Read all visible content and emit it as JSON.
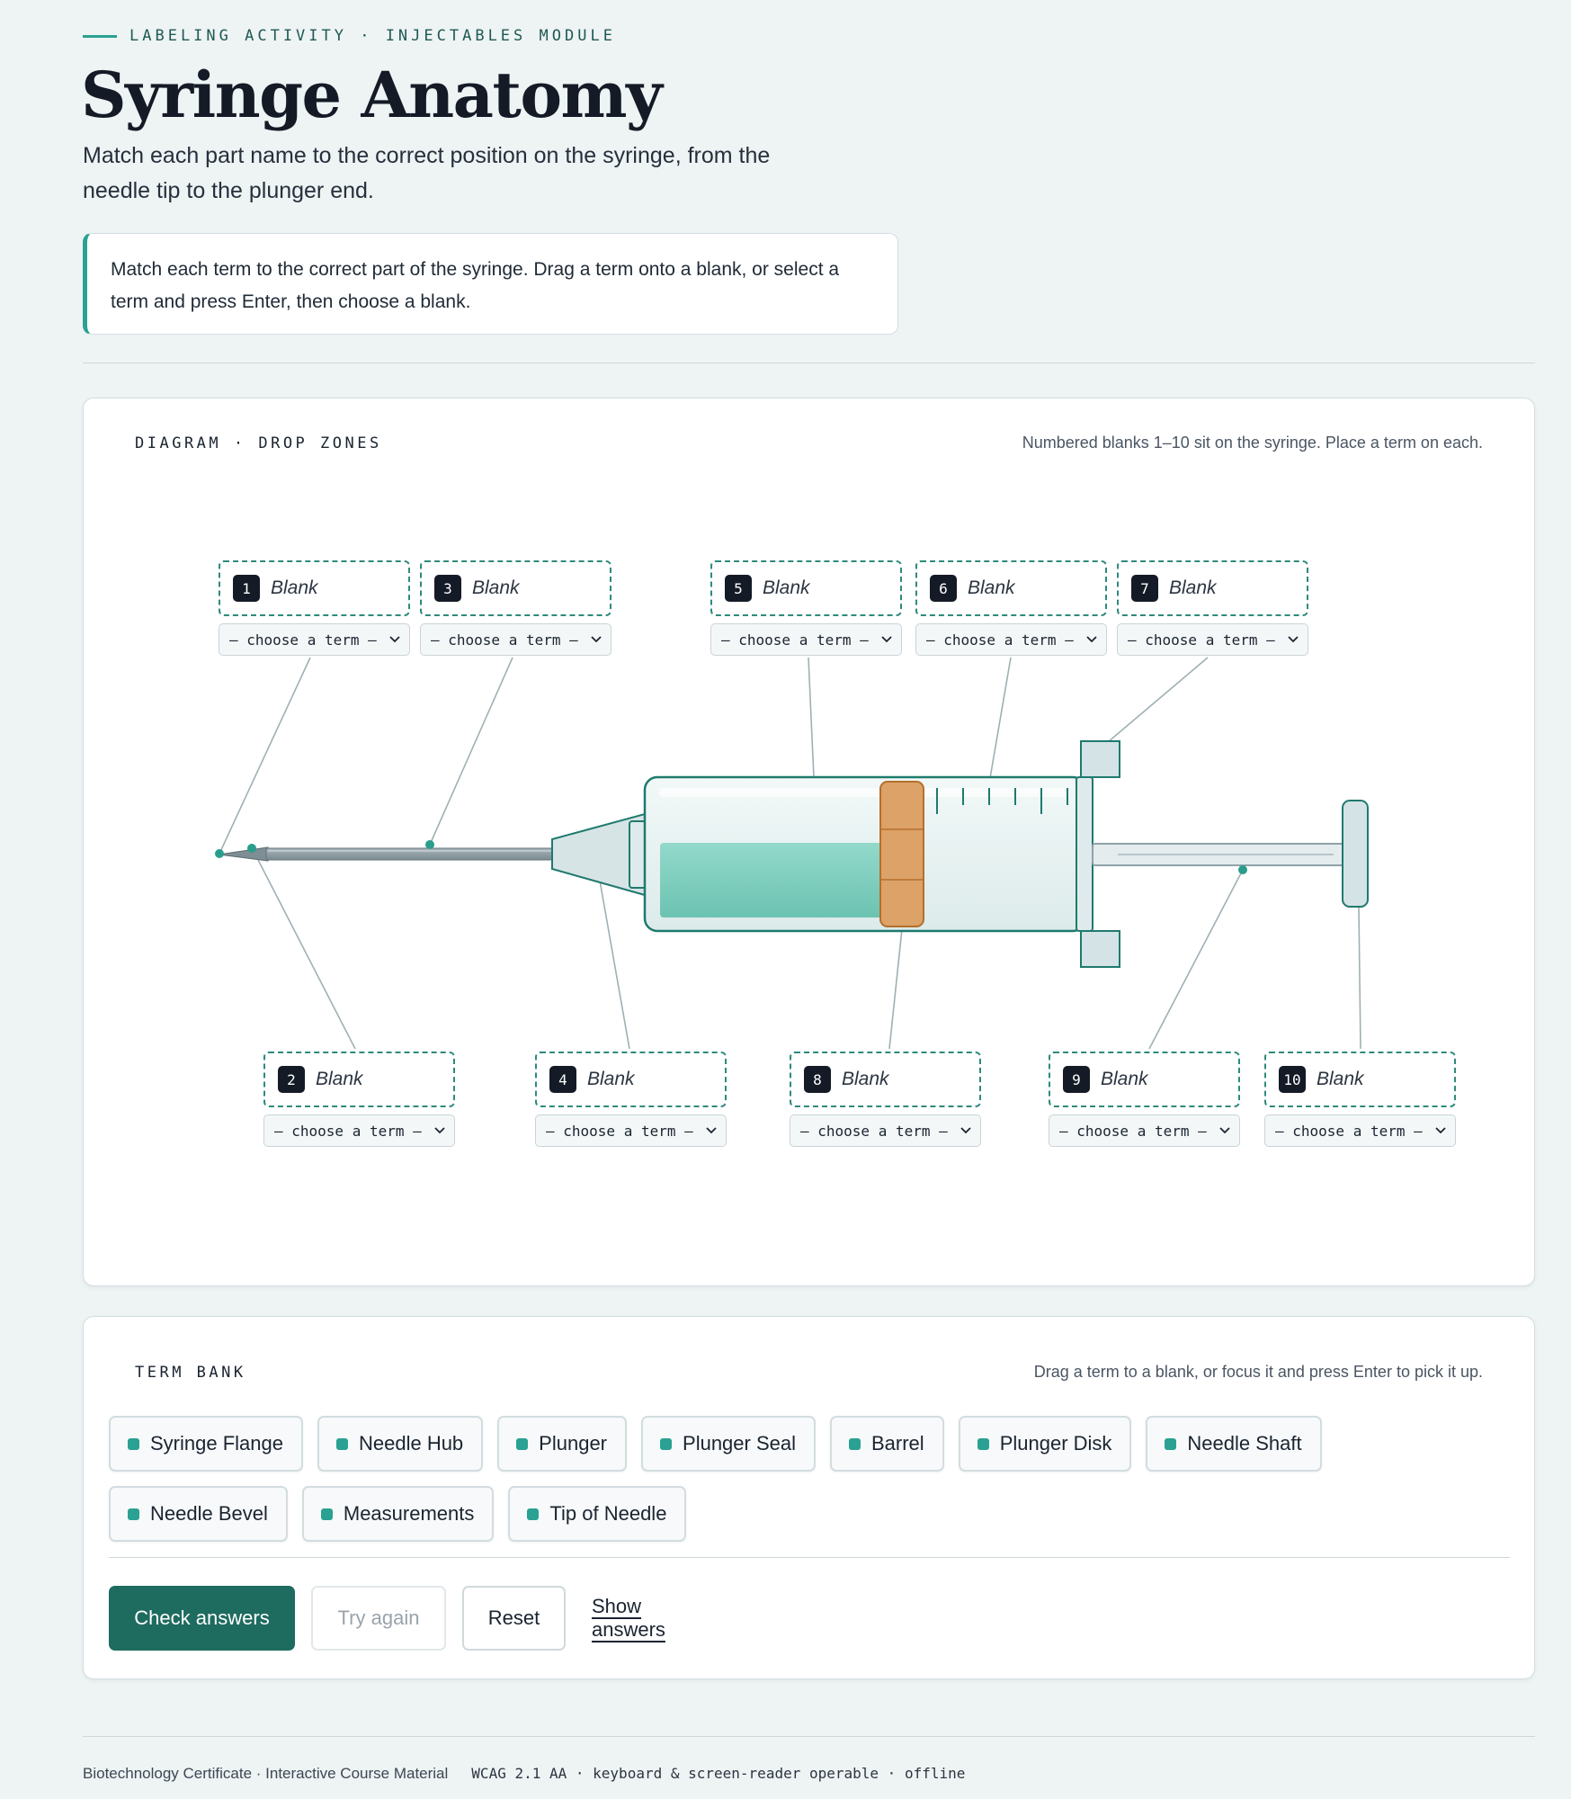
{
  "header": {
    "kicker": "LABELING ACTIVITY · INJECTABLES MODULE",
    "title": "Syringe Anatomy",
    "subtitle": "Match each part name to the correct position on the syringe, from the needle tip to the plunger end.",
    "instructions": "Match each term to the correct part of the syringe. Drag a term onto a blank, or select a term and press Enter, then choose a blank."
  },
  "diagram": {
    "heading": "DIAGRAM · DROP ZONES",
    "hint": "Numbered blanks 1–10 sit on the syringe. Place a term on each.",
    "blank_label": "Blank",
    "select_placeholder": "– choose a term –",
    "blanks": [
      {
        "num": "1"
      },
      {
        "num": "2"
      },
      {
        "num": "3"
      },
      {
        "num": "4"
      },
      {
        "num": "5"
      },
      {
        "num": "6"
      },
      {
        "num": "7"
      },
      {
        "num": "8"
      },
      {
        "num": "9"
      },
      {
        "num": "10"
      }
    ]
  },
  "term_bank": {
    "heading": "TERM BANK",
    "hint": "Drag a term to a blank, or focus it and press Enter to pick it up.",
    "terms": [
      "Syringe Flange",
      "Needle Hub",
      "Plunger",
      "Plunger Seal",
      "Barrel",
      "Plunger Disk",
      "Needle Shaft",
      "Needle Bevel",
      "Measurements",
      "Tip of Needle"
    ]
  },
  "actions": {
    "check": "Check answers",
    "try_again": "Try again",
    "reset": "Reset",
    "show": "Show answers"
  },
  "footer": {
    "left": "Biotechnology Certificate · Interactive Course Material",
    "right": "WCAG 2.1 AA · keyboard & screen-reader operable · offline"
  },
  "colors": {
    "accent": "#2aa192",
    "primary_button": "#1e6b60",
    "plunger_seal": "#dca268",
    "liquid": "#7fcfc0",
    "badge": "#141b26"
  }
}
